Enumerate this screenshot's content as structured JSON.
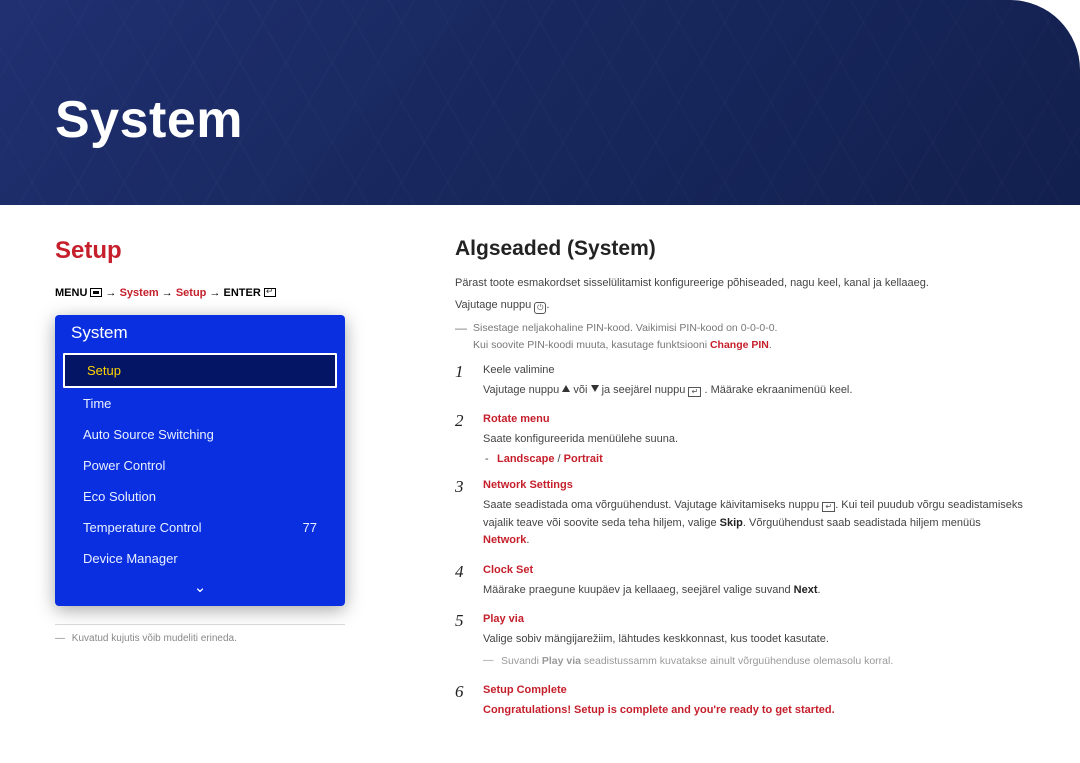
{
  "banner": {
    "title": "System"
  },
  "left": {
    "heading": "Setup",
    "breadcrumb": {
      "menu": "MENU",
      "parts": [
        "System",
        "Setup"
      ],
      "enter": "ENTER"
    },
    "osd": {
      "title": "System",
      "items": [
        {
          "label": "Setup",
          "selected": true
        },
        {
          "label": "Time"
        },
        {
          "label": "Auto Source Switching"
        },
        {
          "label": "Power Control"
        },
        {
          "label": "Eco Solution"
        },
        {
          "label": "Temperature Control",
          "value": "77"
        },
        {
          "label": "Device Manager"
        }
      ]
    },
    "footnote": "Kuvatud kujutis võib mudeliti erineda."
  },
  "right": {
    "heading": "Algseaded (System)",
    "intro": "Pärast toote esmakordset sisselülitamist konfigureerige põhiseaded, nagu keel, kanal ja kellaaeg.",
    "press": "Vajutage nuppu",
    "pin_note_a": "Sisestage neljakohaline PIN-kood. Vaikimisi PIN-kood on 0-0-0-0.",
    "pin_note_b_pre": "Kui soovite PIN-koodi muuta, kasutage funktsiooni ",
    "pin_note_b_red": "Change PIN",
    "steps": [
      {
        "title_plain": "Keele valimine",
        "body_pre": "Vajutage nuppu ",
        "body_mid": " või ",
        "body_post1": " ja seejärel nuppu ",
        "body_post2": ". Määrake ekraanimenüü keel."
      },
      {
        "title_red": "Rotate menu",
        "body": "Saate konfigureerida menüülehe suuna.",
        "subdash": {
          "a": "Landscape",
          "sep": " / ",
          "b": "Portrait"
        }
      },
      {
        "title_red": "Network Settings",
        "body_pre": "Saate seadistada oma võrguühendust. Vajutage käivitamiseks nuppu ",
        "body_mid": ". Kui teil puudub võrgu seadistamiseks vajalik teave või soovite seda teha hiljem, valige ",
        "skip": "Skip",
        "body_post1": ". Võrguühendust saab seadistada hiljem menüüs ",
        "network": "Network",
        "body_post2": "."
      },
      {
        "title_red": "Clock Set",
        "body_pre": "Määrake praegune kuupäev ja kellaaeg, seejärel valige suvand ",
        "next": "Next",
        "body_post": "."
      },
      {
        "title_red": "Play via",
        "body": "Valige sobiv mängijarežiim, lähtudes keskkonnast, kus toodet kasutate.",
        "gray_pre": "Suvandi ",
        "gray_bold": "Play via",
        "gray_post": " seadistussamm kuvatakse ainult võrguühenduse olemasolu korral."
      },
      {
        "title_red": "Setup Complete",
        "congrats": "Congratulations! Setup is complete and you're ready to get started."
      }
    ]
  }
}
